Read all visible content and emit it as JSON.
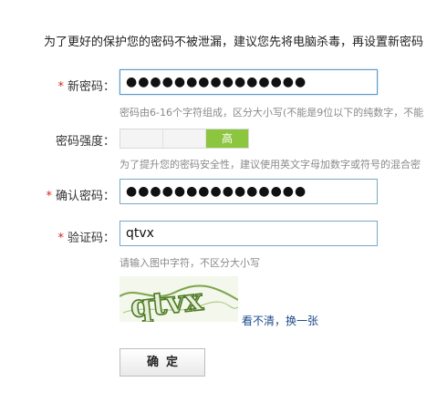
{
  "notice": "为了更好的保护您的密码不被泄漏，建议您先将电脑杀毒，再设置新密码",
  "required_mark": "*",
  "new_password": {
    "label": "新密码：",
    "value": "●●●●●●●●●●●●●●●",
    "hint": "密码由6-16个字符组成，区分大小写(不能是9位以下的纯数字，不能"
  },
  "strength": {
    "label": "密码强度：",
    "levels": [
      "",
      "",
      "高"
    ],
    "active_level": "高",
    "active_color": "#8cc63f",
    "hint": "为了提升您的密码安全性，建议使用英文字母加数字或符号的混合密"
  },
  "confirm_password": {
    "label": "确认密码：",
    "value": "●●●●●●●●●●●●●●●"
  },
  "captcha": {
    "label": "验证码：",
    "value": "qtvx",
    "hint": "请输入图中字符，不区分大小写",
    "image_text": "qtvx",
    "refresh_link": "看不清，换一张"
  },
  "submit_label": "确定",
  "colors": {
    "required": "#d52b1e",
    "input_border": "#7aa7c7",
    "link": "#1a4b8c"
  }
}
